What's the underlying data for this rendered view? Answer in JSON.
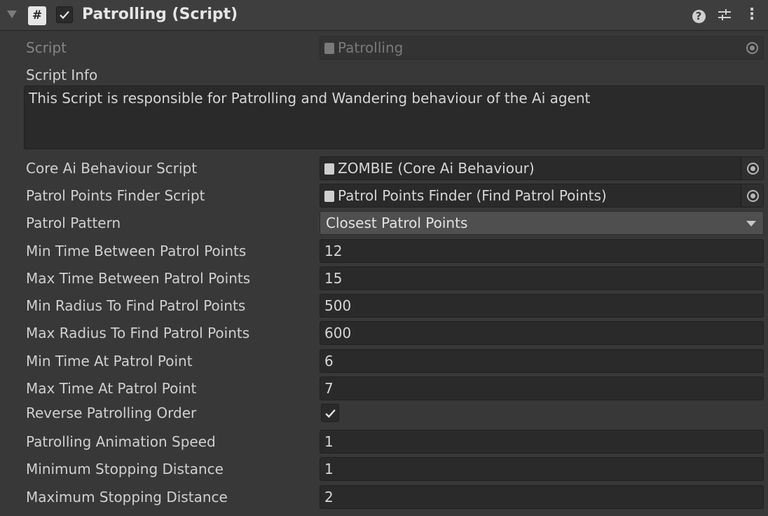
{
  "component": {
    "title": "Patrolling (Script)",
    "script_icon_glyph": "#",
    "enabled": true
  },
  "script_field": {
    "label": "Script",
    "value": "Patrolling"
  },
  "script_info": {
    "label": "Script Info",
    "text": "This Script is responsible for Patrolling and Wandering behaviour of the Ai agent"
  },
  "core_ai": {
    "label": "Core Ai Behaviour Script",
    "value": "ZOMBIE (Core Ai Behaviour)"
  },
  "finder": {
    "label": "Patrol Points Finder Script",
    "value": "Patrol Points Finder (Find Patrol Points)"
  },
  "pattern": {
    "label": "Patrol Pattern",
    "value": "Closest Patrol Points"
  },
  "min_time_between": {
    "label": "Min Time Between Patrol Points",
    "value": "12"
  },
  "max_time_between": {
    "label": "Max Time Between Patrol Points",
    "value": "15"
  },
  "min_radius": {
    "label": "Min Radius To Find Patrol Points",
    "value": "500"
  },
  "max_radius": {
    "label": "Max Radius To Find Patrol Points",
    "value": "600"
  },
  "min_time_at": {
    "label": "Min Time At Patrol Point",
    "value": "6"
  },
  "max_time_at": {
    "label": "Max Time At Patrol Point",
    "value": "7"
  },
  "reverse_order": {
    "label": "Reverse Patrolling Order",
    "checked": true
  },
  "anim_speed": {
    "label": "Patrolling Animation Speed",
    "value": "1"
  },
  "min_stop": {
    "label": "Minimum Stopping Distance",
    "value": "1"
  },
  "max_stop": {
    "label": "Maximum Stopping Distance",
    "value": "2"
  },
  "icons": {
    "help": "?",
    "presets": "sliders-icon",
    "menu": "⋮"
  },
  "colors": {
    "background": "#383838",
    "header": "#3e3e3e",
    "field": "#2a2a2a",
    "dropdown": "#4f4f4f",
    "text": "#d2d2d2"
  }
}
